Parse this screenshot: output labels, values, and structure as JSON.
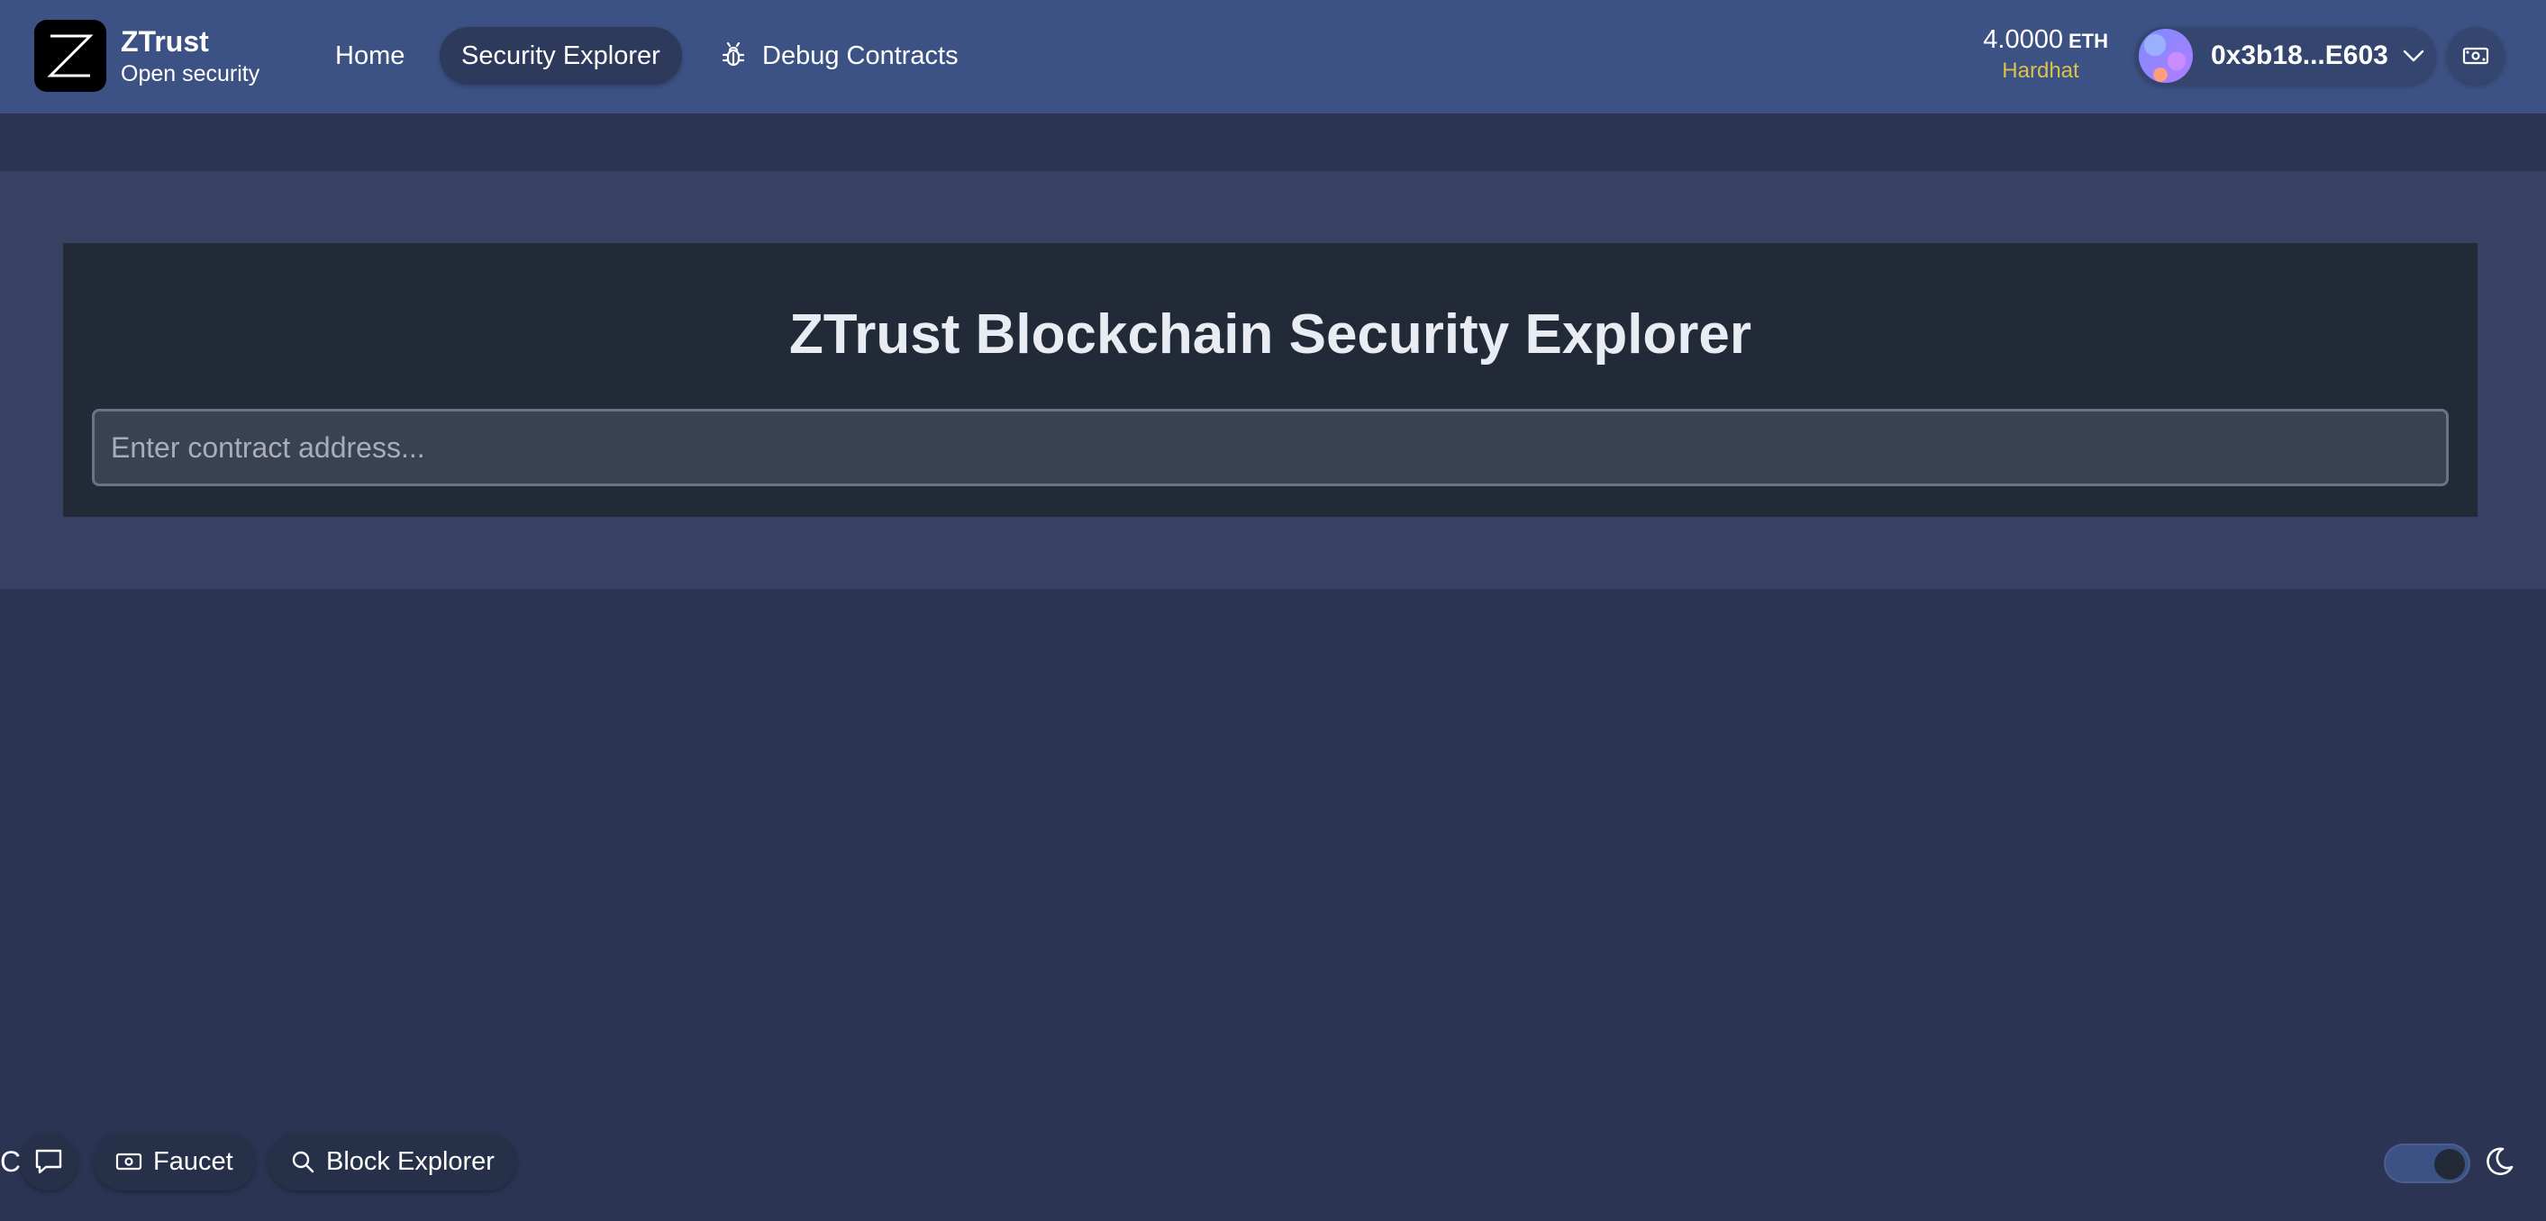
{
  "brand": {
    "title": "ZTrust",
    "subtitle": "Open security",
    "logo_icon": "z-logo-icon"
  },
  "nav": {
    "items": [
      {
        "label": "Home",
        "active": false
      },
      {
        "label": "Security Explorer",
        "active": true
      },
      {
        "label": "Debug Contracts",
        "active": false,
        "icon": "bug-icon"
      }
    ]
  },
  "wallet": {
    "balance": "4.0000",
    "unit": "ETH",
    "network": "Hardhat",
    "network_color": "#d8c24a",
    "address": "0x3b18...E603"
  },
  "main": {
    "title": "ZTrust Blockchain Security Explorer",
    "search": {
      "placeholder": "Enter contract address...",
      "value": ""
    }
  },
  "footer": {
    "chat_text": "C   o        t",
    "faucet_label": "Faucet",
    "block_explorer_label": "Block Explorer",
    "theme": "dark"
  },
  "colors": {
    "navbar": "#3d5284",
    "background": "#2b3452",
    "hero": "#374262",
    "card": "#222a38"
  }
}
